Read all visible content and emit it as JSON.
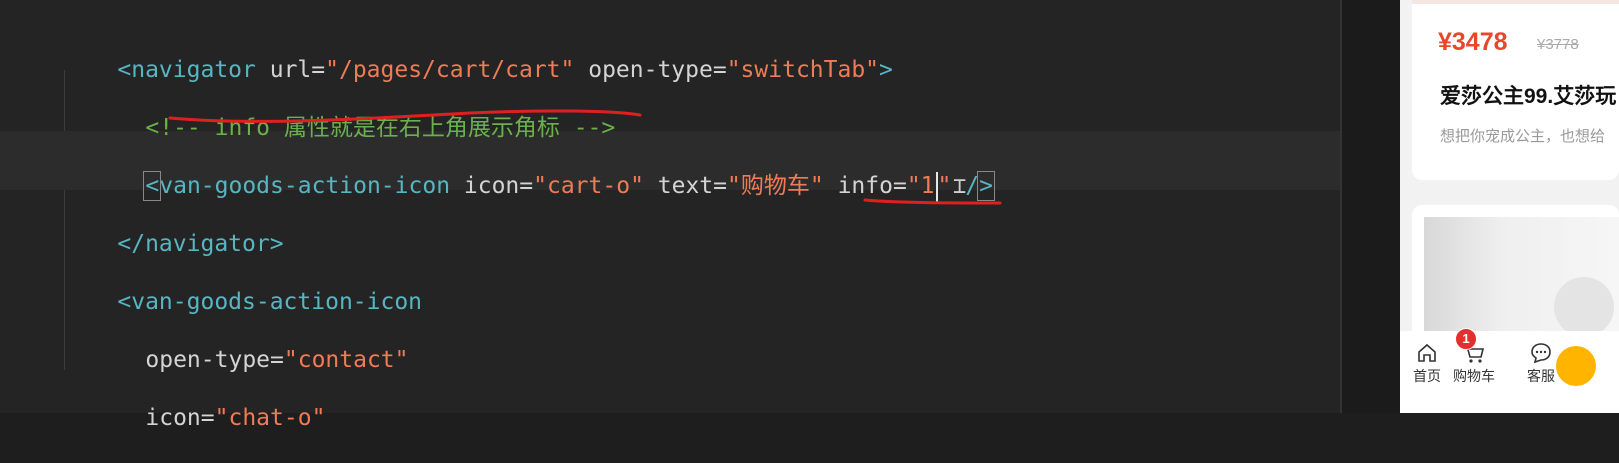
{
  "editor": {
    "lines": [
      {
        "parts": [
          "<navigator",
          " url=",
          "\"/pages/cart/cart\"",
          " open-type=",
          "\"switchTab\"",
          ">"
        ]
      },
      {
        "comment": "<!-- info 属性就是在右上角展示角标 -->"
      },
      {
        "parts": [
          "<",
          "van-goods-action-icon",
          " icon=",
          "\"cart-o\"",
          " text=",
          "\"购物车\"",
          " info=",
          "\"1",
          "\"",
          " ",
          "/",
          ">"
        ]
      },
      {
        "parts": [
          "</navigator>"
        ]
      },
      {
        "parts": [
          "<van-goods-action-icon"
        ]
      },
      {
        "parts": [
          "open-type=",
          "\"contact\""
        ]
      },
      {
        "parts": [
          "icon=",
          "\"chat-o\""
        ]
      }
    ],
    "colors": {
      "tag": "#56b6c2",
      "string": "#f07b55",
      "comment": "#6ab04c",
      "annotation": "#e02020"
    }
  },
  "preview": {
    "price": "¥3478",
    "old_price": "¥3778",
    "title": "爱莎公主99.艾莎玩",
    "desc": "想把你宠成公主，也想给",
    "actions": [
      {
        "label": "首页",
        "icon": "home-icon"
      },
      {
        "label": "购物车",
        "icon": "cart-icon",
        "badge": "1"
      },
      {
        "label": "客服",
        "icon": "chat-icon"
      }
    ],
    "accent": "#e8472b"
  }
}
